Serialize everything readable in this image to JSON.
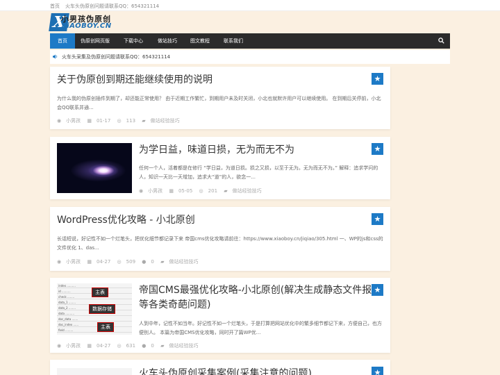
{
  "topbar": {
    "home": "首页",
    "notice": "火车头伪原创问题请联系QQ：654321114"
  },
  "logo": {
    "cn": "小男孩伪原创",
    "en": "XiAOBOY.CN"
  },
  "nav": {
    "items": [
      "首页",
      "伪原创网页版",
      "下载中心",
      "做站技巧",
      "图文教程",
      "联系我们"
    ]
  },
  "notice_bar": {
    "text": "火车头采集及伪原创问题请联系QQ：654321114"
  },
  "posts": [
    {
      "title": "关于伪原创到期还能继续使用的说明",
      "excerpt": "为什么我的伪原创插件到期了，却还能正常使用？ 由于近期工作繁忙，到期用户未及时关闭，小北也就默许用户可以继续使用。 在到期后关停前，小北会QQ联系并通...",
      "author": "小男孩",
      "date": "01-17",
      "views": "113",
      "comments": "",
      "category": "做站经验技巧"
    },
    {
      "title": "为学日益，味道日损，无为而无不为",
      "excerpt": "任何一个人，活着都是在修行 “学日益，为道日损。损之又损，以至于无为。无为而无不为。” 解释：追求学问的人，知识一天比一天增加，追求大“道”的人，欲念一...",
      "author": "小男孩",
      "date": "05-05",
      "views": "201",
      "comments": "",
      "category": "做站经验技巧"
    },
    {
      "title": "WordPress优化攻略 - 小北原创",
      "excerpt": "长话短说，好记性不如一个烂笔头，把优化细节都记录下来 帝国cms优化攻略请前往：https://www.xiaoboy.cn/jiqiao/305.html 一、WP的js和css的文件优化 1、das...",
      "author": "小男孩",
      "date": "04-27",
      "views": "509",
      "comments": "0",
      "category": "做站经验技巧"
    },
    {
      "title_line1": "帝国CMS最强优化攻略-小北原创(解决生成静态文件报",
      "title_line2": "等各类奇葩问题)",
      "excerpt": "人到中年，记性不如当年。好记性不如一个烂笔头，于是打算把网站优化中的繁多细节都记下来，方便自己，也方便别人。 本篇为帝国CMS优化攻略，同时开了篇WP优...",
      "author": "小男孩",
      "date": "04-27",
      "views": "631",
      "comments": "0",
      "category": "做站经验技巧",
      "thumb_tags": [
        "主表",
        "数据存储",
        "主表"
      ]
    },
    {
      "title": "火车头伪原创采集案例(采集注意的问题)"
    }
  ],
  "colors": {
    "accent": "#1d7ac6",
    "nav_bg": "#2b2b2b",
    "page_bg": "#fbf0e1"
  },
  "icons": [
    "search-icon",
    "speaker-icon",
    "star-icon",
    "user-icon",
    "calendar-icon",
    "eye-icon",
    "comment-icon",
    "folder-icon"
  ]
}
